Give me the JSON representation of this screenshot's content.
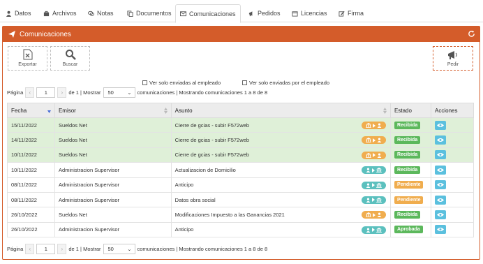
{
  "tabs": [
    {
      "label": "Datos",
      "icon": "user-icon"
    },
    {
      "label": "Archivos",
      "icon": "briefcase-icon"
    },
    {
      "label": "Notas",
      "icon": "comments-icon"
    },
    {
      "label": "Documentos",
      "icon": "copy-icon"
    },
    {
      "label": "Comunicaciones",
      "icon": "envelope-icon"
    },
    {
      "label": "Pedidos",
      "icon": "bullhorn-icon"
    },
    {
      "label": "Licencias",
      "icon": "calendar-icon"
    },
    {
      "label": "Firma",
      "icon": "pencil-icon"
    }
  ],
  "panel": {
    "title": "Comunicaciones"
  },
  "toolbar": {
    "export_label": "Exportar",
    "search_label": "Buscar",
    "request_label": "Pedir"
  },
  "filters": {
    "only_sent_to_employee": "Ver solo enviadas al empleado",
    "only_sent_by_employee": "Ver solo enviadas por el empleado"
  },
  "pager": {
    "page_label": "Página",
    "prev": "‹",
    "next": "›",
    "page": "1",
    "of_text": "de 1 | Mostrar",
    "per_page": "50",
    "summary": "comunicaciones | Mostrando comunicaciones 1 a 8 de 8"
  },
  "table": {
    "headers": [
      "Fecha",
      "Emisor",
      "Asunto",
      "Estado",
      "Acciones"
    ],
    "rows": [
      {
        "fecha": "15/11/2022",
        "emisor": "Sueldos Net",
        "asunto": "Cierre de gcias - subir F572web",
        "estado": "Recibida",
        "status_color": "#5cb85c",
        "direction": "out",
        "highlight": true
      },
      {
        "fecha": "14/11/2022",
        "emisor": "Sueldos Net",
        "asunto": "Cierre de gcias - subir F572web",
        "estado": "Recibida",
        "status_color": "#5cb85c",
        "direction": "out",
        "highlight": true
      },
      {
        "fecha": "10/11/2022",
        "emisor": "Sueldos Net",
        "asunto": "Cierre de gcias - subir F572web",
        "estado": "Recibida",
        "status_color": "#5cb85c",
        "direction": "out",
        "highlight": true
      },
      {
        "fecha": "10/11/2022",
        "emisor": "Administracion Supervisor",
        "asunto": "Actualizacion de Domicilio",
        "estado": "Recibida",
        "status_color": "#5cb85c",
        "direction": "in",
        "highlight": false
      },
      {
        "fecha": "08/11/2022",
        "emisor": "Administracion Supervisor",
        "asunto": "Anticipo",
        "estado": "Pendiente",
        "status_color": "#f0ad4e",
        "direction": "in",
        "highlight": false
      },
      {
        "fecha": "08/11/2022",
        "emisor": "Administracion Supervisor",
        "asunto": "Datos obra social",
        "estado": "Pendiente",
        "status_color": "#f0ad4e",
        "direction": "in",
        "highlight": false
      },
      {
        "fecha": "26/10/2022",
        "emisor": "Sueldos Net",
        "asunto": "Modificaciones Impuesto a las Ganancias 2021",
        "estado": "Recibida",
        "status_color": "#5cb85c",
        "direction": "out",
        "highlight": false
      },
      {
        "fecha": "26/10/2022",
        "emisor": "Administracion Supervisor",
        "asunto": "Anticipo",
        "estado": "Aprobada",
        "status_color": "#5cb85c",
        "direction": "in",
        "highlight": false
      }
    ]
  },
  "colors": {
    "accent": "#d45c2a",
    "success": "#5cb85c",
    "warning": "#f0ad4e",
    "info": "#5bc0de",
    "row_highlight": "#dff0d8"
  }
}
